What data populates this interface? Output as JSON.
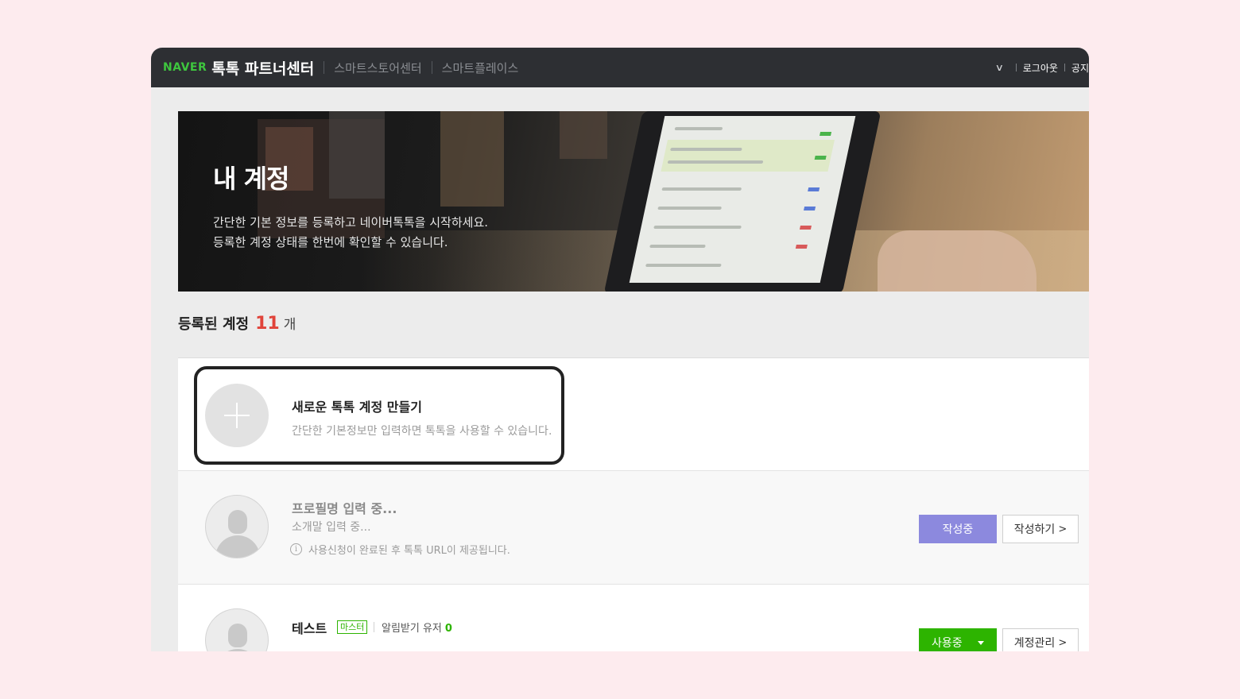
{
  "topbar": {
    "logo": "NAVER",
    "brand": "톡톡 파트너센터",
    "nav": [
      "스마트스토어센터",
      "스마트플레이스"
    ],
    "logout": "로그아웃",
    "notice": "공지"
  },
  "banner": {
    "heading": "내 계정",
    "line1": "간단한 기본 정보를 등록하고 네이버톡톡을 시작하세요.",
    "line2": "등록한 계정 상태를 한번에 확인할 수 있습니다."
  },
  "registered": {
    "label": "등록된 계정",
    "count": "11",
    "unit": "개"
  },
  "new_account": {
    "title": "새로운 톡톡 계정 만들기",
    "description": "간단한 기본정보만 입력하면 톡톡을 사용할 수 있습니다."
  },
  "accounts": [
    {
      "name": "프로필명 입력 중...",
      "intro": "소개말 입력 중...",
      "notice": "사용신청이 완료된 후 톡톡 URL이 제공됩니다.",
      "status": "작성중",
      "action": "작성하기"
    },
    {
      "name": "테스트",
      "role": "마스터",
      "alarm_label": "알림받기 유저",
      "alarm_count": "0",
      "status": "사용중",
      "action": "계정관리"
    }
  ],
  "colors": {
    "topbar": "#2d2f33",
    "naver_green": "#3ec63e",
    "count_red": "#e0433a",
    "status_purple": "#8c89de",
    "status_green": "#2db400",
    "highlight_border": "#222222"
  }
}
